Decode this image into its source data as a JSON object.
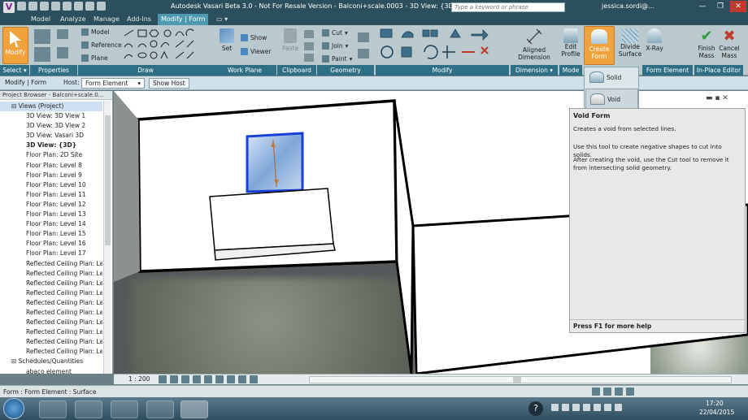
{
  "window": {
    "title": "Autodesk Vasari Beta 3.0 - Not For Resale Version -    Balconi+scale.0003 - 3D View: {3D}",
    "search_placeholder": "Type a keyword or phrase",
    "user": "jessica.sordi@...",
    "minimize": "—",
    "restore": "❐",
    "close": "✕"
  },
  "tabs": [
    "Model",
    "Analyze",
    "Manage",
    "Add-Ins",
    "Modify | Form"
  ],
  "ribbon": {
    "modify": "Modify",
    "select": "Select ▾",
    "properties": "Properties",
    "draw": "Draw",
    "model": "Model",
    "reference": "Reference",
    "plane": "Plane",
    "set": "Set",
    "show": "Show",
    "viewer": "Viewer",
    "work_plane": "Work Plane",
    "paste": "Paste",
    "clipboard": "Clipboard",
    "cut": "Cut",
    "join": "Join",
    "paint": "Paint",
    "geometry": "Geometry",
    "modify_panel": "Modify",
    "aligned_dimension": "Aligned Dimension",
    "dimension": "Dimension ▾",
    "edit_profile": "Edit Profile",
    "mode": "Mode",
    "create_form": "Create Form",
    "divide_surface": "Divide Surface",
    "xray": "X-Ray",
    "form_element": "Form Element",
    "finish_mass": "Finish Mass",
    "cancel_mass": "Cancel Mass",
    "in_place_editor": "In-Place Editor"
  },
  "dropdown": {
    "solid_form": "Solid Form",
    "void_form": "Void Form"
  },
  "options_bar": {
    "context": "Modify | Form",
    "host_label": "Host:",
    "host_value": "Form Element",
    "show_host": "Show Host"
  },
  "browser": {
    "header": "Project Browser - Balconi+scale.0...",
    "root": "Views (Project)",
    "items": [
      "3D View: 3D View 1",
      "3D View: 3D View 2",
      "3D View: Vasari 3D",
      "3D View: {3D}",
      "Floor Plan: 2D Site",
      "Floor Plan: Level 8",
      "Floor Plan: Level 9",
      "Floor Plan: Level 10",
      "Floor Plan: Level 11",
      "Floor Plan: Level 12",
      "Floor Plan: Level 13",
      "Floor Plan: Level 14",
      "Floor Plan: Level 15",
      "Floor Plan: Level 16",
      "Floor Plan: Level 17",
      "Reflected Ceiling Plan: Lev",
      "Reflected Ceiling Plan: Lev",
      "Reflected Ceiling Plan: Lev",
      "Reflected Ceiling Plan: Lev",
      "Reflected Ceiling Plan: Lev",
      "Reflected Ceiling Plan: Lev",
      "Reflected Ceiling Plan: Lev",
      "Reflected Ceiling Plan: Lev",
      "Reflected Ceiling Plan: Lev",
      "Reflected Ceiling Plan: Lev"
    ],
    "schedules": "Schedules/Quantities",
    "schedule_child": "abaco element"
  },
  "tooltip": {
    "title": "Void Form",
    "line1": "Creates a void from selected lines.",
    "line2": "Use this tool to create negative shapes to cut into solids.",
    "line3": "After creating the void, use the Cut tool to remove it from intersecting solid geometry.",
    "footer": "Press F1 for more help"
  },
  "viewbar": {
    "scale": "1 : 200"
  },
  "status": {
    "text": "Form : Form Element : Surface"
  },
  "taskbar": {
    "time": "17:20",
    "date": "22/04/2015"
  },
  "colors": {
    "ribbon_bg": "#b9c9cd",
    "accent_orange": "#f0a23c",
    "title_bg": "#2b4f5c"
  }
}
